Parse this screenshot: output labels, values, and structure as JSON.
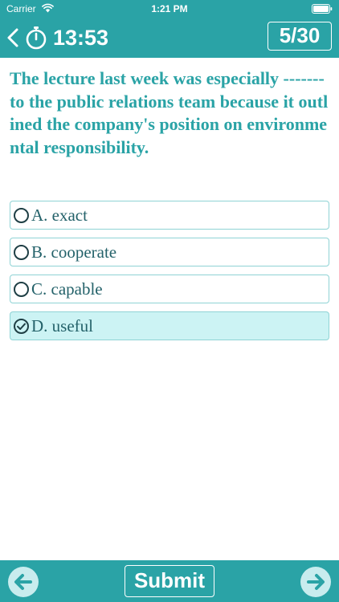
{
  "colors": {
    "accent": "#2aa3a6",
    "option_border": "#8fd3d5",
    "option_selected_bg": "#ccf3f4",
    "option_text": "#24626a",
    "nav_button_fill": "#c8ecee"
  },
  "status_bar": {
    "carrier": "Carrier",
    "time": "1:21 PM",
    "icons": [
      "wifi-icon",
      "battery-icon"
    ]
  },
  "nav": {
    "back_icon": "chevron-left-icon",
    "timer_icon": "stopwatch-icon",
    "timer": "13:53",
    "progress": "5/30"
  },
  "question": {
    "text": "The lecture last week was especially ------- to the public relations team because it outlined the company's position on environmental responsibility."
  },
  "options": [
    {
      "label": "A. exact",
      "selected": false
    },
    {
      "label": "B. cooperate",
      "selected": false
    },
    {
      "label": "C. capable",
      "selected": false
    },
    {
      "label": "D. useful",
      "selected": true
    }
  ],
  "footer": {
    "prev_icon": "arrow-left-circle-icon",
    "submit_label": "Submit",
    "next_icon": "arrow-right-circle-icon"
  }
}
